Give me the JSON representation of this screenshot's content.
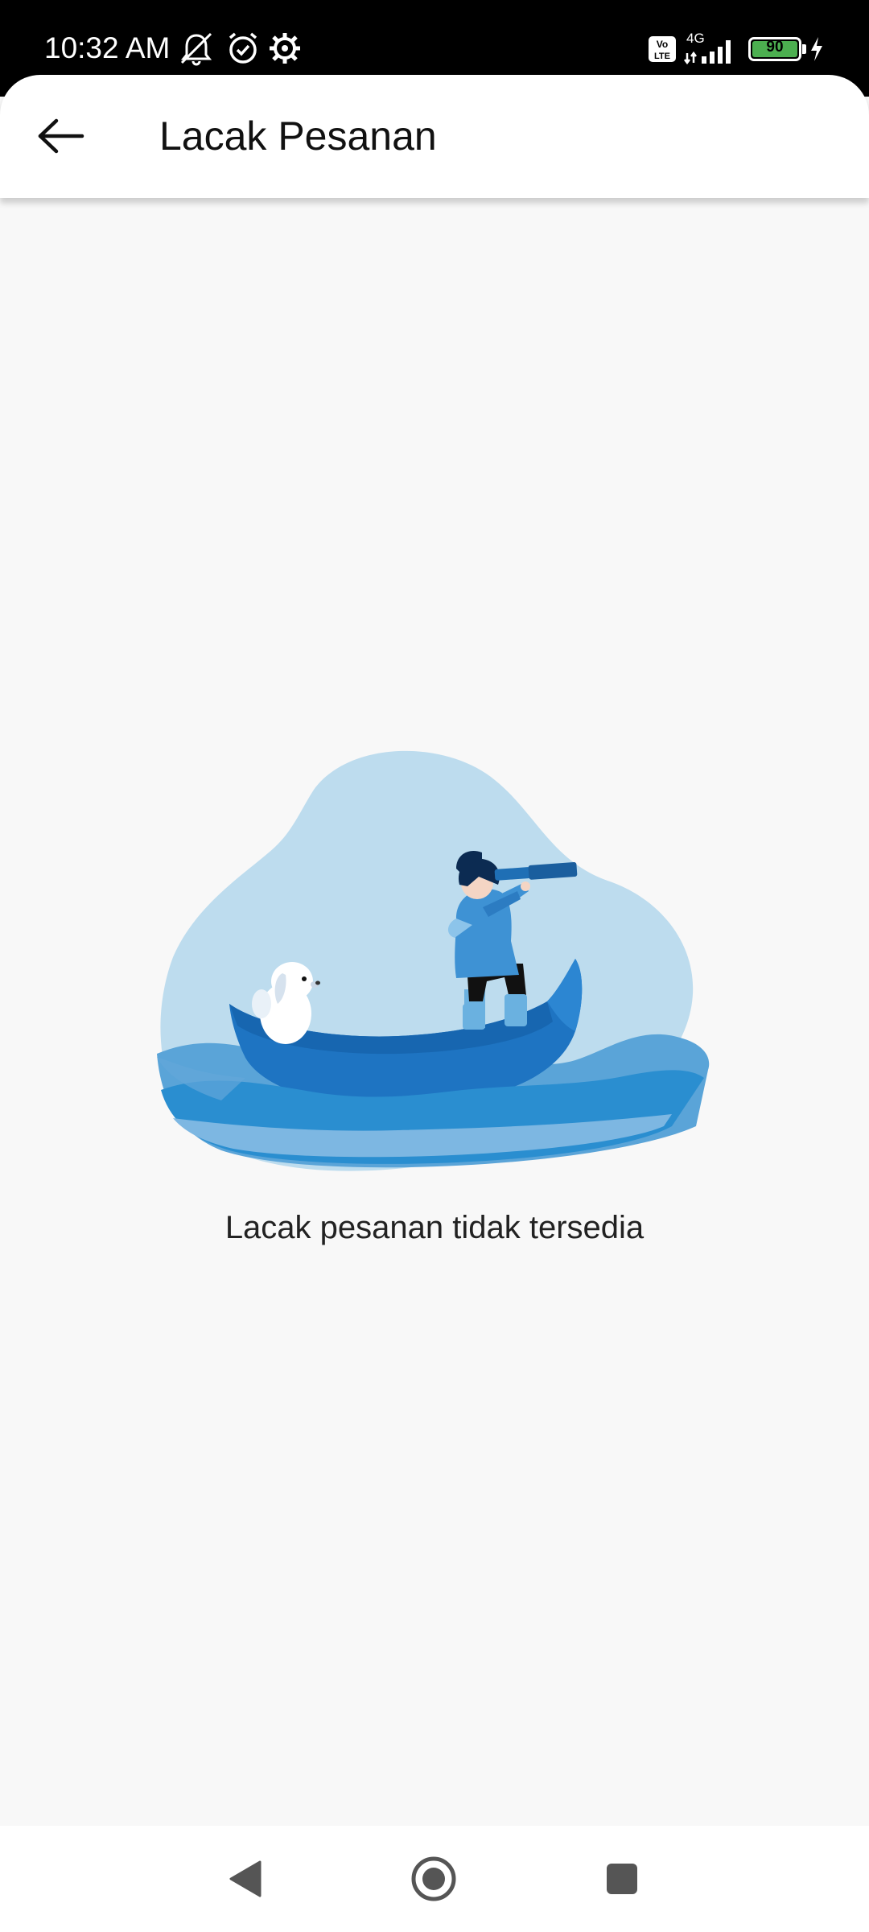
{
  "status_bar": {
    "time": "10:32 AM",
    "icons": [
      "mute-icon",
      "alarm-icon",
      "settings-icon"
    ],
    "volte_label": "Vo LTE",
    "network_label": "4G",
    "battery_level": "90"
  },
  "app_bar": {
    "title": "Lacak Pesanan",
    "back_icon": "arrow-left-icon"
  },
  "main": {
    "illustration": "empty-state-boat-telescope",
    "message": "Lacak pesanan tidak tersedia"
  },
  "nav_bar": {
    "buttons": [
      "back-triangle-icon",
      "home-circle-icon",
      "recents-square-icon"
    ]
  },
  "colors": {
    "blob": "#bddcee",
    "boat": "#1e74c2",
    "water": "#2a8ed0",
    "background": "#f8f8f8",
    "battery": "#4caf50"
  }
}
